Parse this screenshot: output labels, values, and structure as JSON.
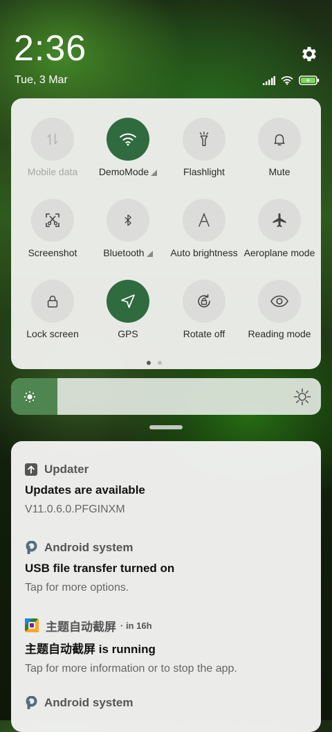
{
  "status": {
    "time": "2:36",
    "date": "Tue, 3 Mar",
    "battery_color": "#7ed957"
  },
  "quick_settings": {
    "tiles": [
      {
        "label": "Mobile data",
        "icon": "mobile-data-icon",
        "state": "unavailable"
      },
      {
        "label": "DemoMode",
        "icon": "wifi-icon",
        "state": "on",
        "has_arrow": true
      },
      {
        "label": "Flashlight",
        "icon": "flashlight-icon",
        "state": "off"
      },
      {
        "label": "Mute",
        "icon": "bell-icon",
        "state": "off"
      },
      {
        "label": "Screenshot",
        "icon": "screenshot-icon",
        "state": "off"
      },
      {
        "label": "Bluetooth",
        "icon": "bluetooth-icon",
        "state": "off",
        "has_arrow": true
      },
      {
        "label": "Auto brightness",
        "icon": "auto-brightness-icon",
        "state": "off"
      },
      {
        "label": "Aeroplane mode",
        "icon": "aeroplane-icon",
        "state": "off"
      },
      {
        "label": "Lock screen",
        "icon": "lock-icon",
        "state": "off"
      },
      {
        "label": "GPS",
        "icon": "gps-icon",
        "state": "on"
      },
      {
        "label": "Rotate off",
        "icon": "rotate-lock-icon",
        "state": "off"
      },
      {
        "label": "Reading mode",
        "icon": "eye-icon",
        "state": "off"
      }
    ],
    "page_count": 2,
    "active_page": 1,
    "active_color": "#2f6b3f"
  },
  "brightness": {
    "level": 0.15,
    "fill_color": "#4f8550"
  },
  "notifications": [
    {
      "app": "Updater",
      "icon": "updater-icon",
      "time": "",
      "title": "Updates are available",
      "text": "V11.0.6.0.PFGINXM"
    },
    {
      "app": "Android system",
      "icon": "android-system-icon",
      "time": "",
      "title": "USB file transfer turned on",
      "text": "Tap for more options."
    },
    {
      "app": "主题自动截屏",
      "icon": "theme-screenshot-app-icon",
      "time": "· in 16h",
      "title": "主题自动截屏 is running",
      "text": "Tap for more information or to stop the app."
    },
    {
      "app": "Android system",
      "icon": "android-system-icon",
      "time": "",
      "title": "",
      "text": ""
    }
  ]
}
